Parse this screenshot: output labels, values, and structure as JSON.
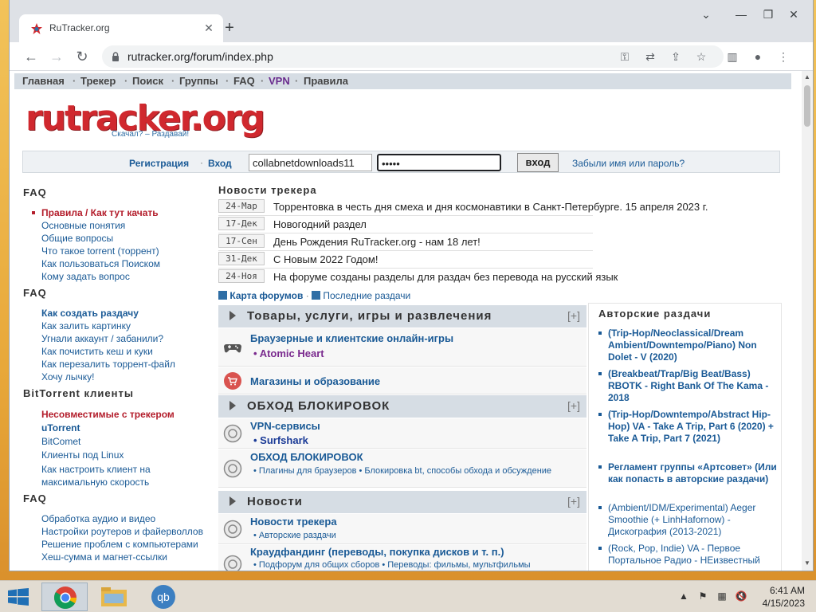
{
  "browser": {
    "tab_title": "RuTracker.org",
    "url": "rutracker.org/forum/index.php"
  },
  "site": {
    "topmenu": [
      "Главная",
      "Трекер",
      "Поиск",
      "Группы",
      "FAQ",
      "VPN",
      "Правила"
    ],
    "logo_text": "rutracker.org",
    "logo_tagline": "Скачал? – Раздавай!",
    "login": {
      "register_label": "Регистрация",
      "enter_label": "Вход",
      "username_value": "collabnetdownloads11",
      "password_value": "•••••",
      "submit_label": "вход",
      "forgot_label": "Забыли имя или пароль?"
    }
  },
  "sidebar": {
    "sections": [
      {
        "title": "FAQ",
        "items": [
          "Правила / Как тут качать",
          "Основные понятия",
          "Общие вопросы",
          "Что такое torrent (торрент)",
          "Как пользоваться Поиском",
          "Кому задать вопрос"
        ]
      },
      {
        "title": "FAQ",
        "items": [
          "Как создать раздачу",
          "Как залить картинку",
          "Угнали аккаунт / забанили?",
          "Как почистить кеш и куки",
          "Как перезалить торрент-файл",
          "Хочу лычку!"
        ]
      },
      {
        "title": "BitTorrent клиенты",
        "items": [
          "Несовместимые с трекером",
          "uTorrent",
          "BitComet",
          "Клиенты под Linux",
          "Как настроить клиент на максимальную скорость"
        ]
      },
      {
        "title": "FAQ",
        "items": [
          "Обработка аудио и видео",
          "Настройки роутеров и файерволлов",
          "Решение проблем с компьютерами",
          "Хеш-сумма и магнет-ссылки"
        ]
      }
    ]
  },
  "news": {
    "title": "Новости трекера",
    "items": [
      {
        "date": "24-Мар",
        "text": "Торрентовка в честь дня смеха и дня космонавтики в Санкт-Петербурге. 15 апреля 2023 г."
      },
      {
        "date": "17-Дек",
        "text": "Новогодний раздел"
      },
      {
        "date": "17-Сен",
        "text": "День Рождения RuTracker.org - нам 18 лет!"
      },
      {
        "date": "31-Дек",
        "text": "С Новым 2022 Годом!"
      },
      {
        "date": "24-Ноя",
        "text": "На форуме созданы разделы для раздач без перевода на русский язык"
      }
    ],
    "map_link": "Карта форумов",
    "recent_link": "Последние раздачи"
  },
  "categories": [
    {
      "title": "Товары, услуги, игры и развлечения",
      "plus": "[+]"
    },
    {
      "title": "ОБХОД БЛОКИРОВОК",
      "plus": "[+]"
    },
    {
      "title": "Новости",
      "plus": "[+]"
    }
  ],
  "forums": [
    {
      "name": "Браузерные и клиентские онлайн-игры",
      "sub": "Atomic Heart"
    },
    {
      "name": "Магазины и образование",
      "sub": ""
    },
    {
      "name": "VPN-сервисы",
      "sub": "Surfshark"
    },
    {
      "name": "ОБХОД БЛОКИРОВОК",
      "sub": "Плагины для браузеров • Блокировка bt, способы обхода и обсуждение"
    },
    {
      "name": "Новости трекера",
      "sub": "Авторские раздачи"
    },
    {
      "name": "Краудфандинг (переводы, покупка дисков и т. п.)",
      "sub": "Подфорум для общих сборов • Переводы: фильмы, мультфильмы"
    }
  ],
  "author_releases": {
    "title": "Авторские раздачи",
    "items": [
      "(Trip-Hop/Neoclassical/Dream Ambient/Downtempo/Piano) Non Dolet - V (2020)",
      "(Breakbeat/Trap/Big Beat/Bass) RBOTK - Right Bank Of The Kama - 2018",
      "(Trip-Hop/Downtempo/Abstract Hip-Hop) VA - Take A Trip, Part 6 (2020) + Take A Trip, Part 7 (2021)",
      "Регламент группы «Артсовет» (Или как попасть в авторские раздачи)",
      "(Ambient/IDM/Experimental) Aeger Smoothie (+ LinhHafornow) - Дискография (2013-2021)",
      "(Rock, Pop, Indie) VA - Первое Портальное Радио - НЕизвестный"
    ]
  },
  "taskbar": {
    "time": "6:41 AM",
    "date": "4/15/2023"
  }
}
